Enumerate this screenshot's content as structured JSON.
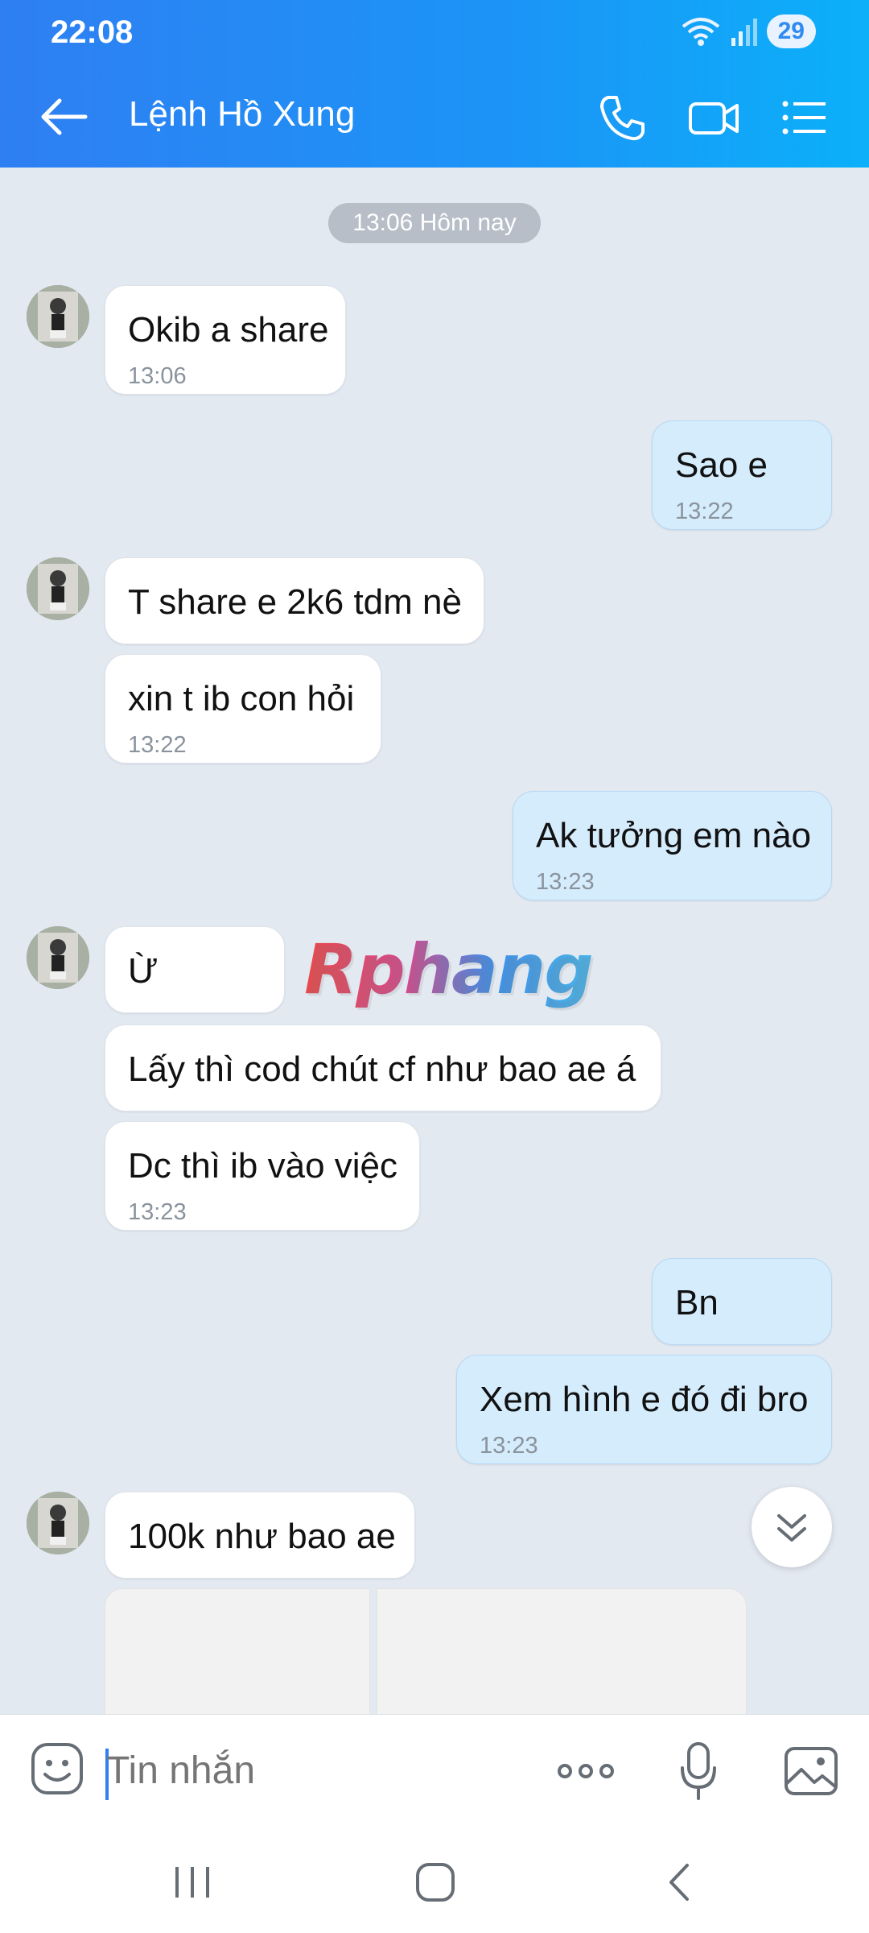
{
  "status_bar": {
    "time": "22:08",
    "battery": "29"
  },
  "header": {
    "title": "Lệnh Hồ Xung"
  },
  "date_separator": "13:06 Hôm nay",
  "messages": [
    {
      "text": "Okib a share",
      "time": "13:06"
    },
    {
      "text": "Sao e",
      "time": "13:22"
    },
    {
      "text": "T share e 2k6 tdm nè"
    },
    {
      "text": "xin t ib con hỏi",
      "time": "13:22"
    },
    {
      "text": "Ak tưởng em nào",
      "time": "13:23"
    },
    {
      "text": "Ừ"
    },
    {
      "text": "Lấy thì cod chút cf như bao ae á"
    },
    {
      "text": "Dc thì ib vào việc",
      "time": "13:23"
    },
    {
      "text": "Bn"
    },
    {
      "text": "Xem hình e đó đi bro",
      "time": "13:23"
    },
    {
      "text": "100k như bao ae"
    }
  ],
  "watermark": "Rphang",
  "input": {
    "placeholder": "Tin nhắn"
  },
  "icons": {
    "back": "arrow-left-icon",
    "call": "phone-icon",
    "video": "video-icon",
    "menu": "list-icon",
    "emoji": "emoji-icon",
    "more": "more-dots-icon",
    "mic": "microphone-icon",
    "gallery": "image-icon",
    "scroll": "chevron-double-down-icon"
  },
  "colors": {
    "header_start": "#2f7ff2",
    "header_end": "#0bb0f9",
    "incoming_bubble": "#ffffff",
    "outgoing_bubble": "#d5ecfd",
    "chat_bg": "#e3e9f1"
  }
}
